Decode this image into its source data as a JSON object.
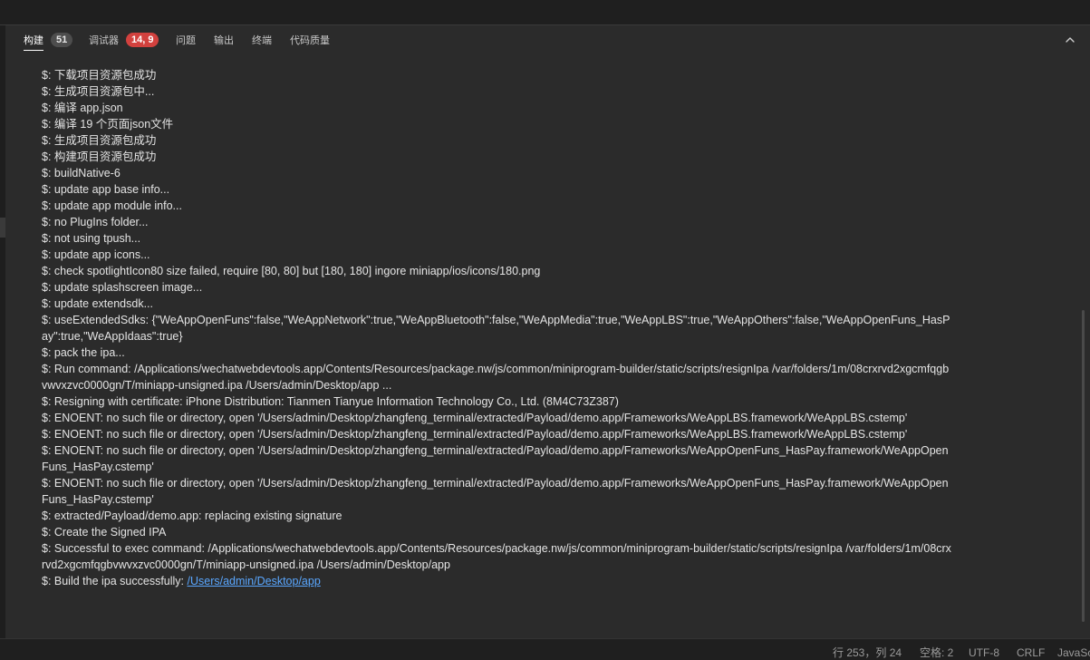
{
  "tabs": [
    {
      "label": "构建",
      "badge": "51"
    },
    {
      "label": "调试器",
      "badge": "14, 9"
    },
    {
      "label": "问题"
    },
    {
      "label": "输出"
    },
    {
      "label": "终端"
    },
    {
      "label": "代码质量"
    }
  ],
  "collapse_icon": "chevron-up-icon",
  "colors": {
    "panel_bg": "#2b2b2b",
    "badge_gray": "#4d4d4d",
    "badge_red": "#d2413e",
    "link": "#5aa7ff",
    "text": "#e4e4e4"
  },
  "log": {
    "lines": [
      "$: 下载项目资源包成功",
      "$: 生成项目资源包中...",
      "$: 编译 app.json",
      "$: 编译 19 个页面json文件",
      "$: 生成项目资源包成功",
      "$: 构建项目资源包成功",
      "$: buildNative-6",
      "$: update app base info...",
      "$: update app module info...",
      "$: no PlugIns folder...",
      "$: not using tpush...",
      "$: update app icons...",
      "$: check spotlightIcon80 size failed, require [80, 80] but [180, 180] ingore miniapp/ios/icons/180.png",
      "$: update splashscreen image...",
      "$: update extendsdk...",
      "$: useExtendedSdks: {\"WeAppOpenFuns\":false,\"WeAppNetwork\":true,\"WeAppBluetooth\":false,\"WeAppMedia\":true,\"WeAppLBS\":true,\"WeAppOthers\":false,\"WeAppOpenFuns_HasPay\":true,\"WeAppIdaas\":true}",
      "$: pack the ipa...",
      "$: Run command: /Applications/wechatwebdevtools.app/Contents/Resources/package.nw/js/common/miniprogram-builder/static/scripts/resignIpa /var/folders/1m/08crxrvd2xgcmfqgbvwvxzvc0000gn/T/miniapp-unsigned.ipa /Users/admin/Desktop/app ...",
      "$: Resigning with certificate: iPhone Distribution: Tianmen Tianyue Information Technology Co., Ltd. (8M4C73Z387)",
      "$: ENOENT: no such file or directory, open '/Users/admin/Desktop/zhangfeng_terminal/extracted/Payload/demo.app/Frameworks/WeAppLBS.framework/WeAppLBS.cstemp'",
      "$: ENOENT: no such file or directory, open '/Users/admin/Desktop/zhangfeng_terminal/extracted/Payload/demo.app/Frameworks/WeAppLBS.framework/WeAppLBS.cstemp'",
      "$: ENOENT: no such file or directory, open '/Users/admin/Desktop/zhangfeng_terminal/extracted/Payload/demo.app/Frameworks/WeAppOpenFuns_HasPay.framework/WeAppOpenFuns_HasPay.cstemp'",
      "$: ENOENT: no such file or directory, open '/Users/admin/Desktop/zhangfeng_terminal/extracted/Payload/demo.app/Frameworks/WeAppOpenFuns_HasPay.framework/WeAppOpenFuns_HasPay.cstemp'",
      "$: extracted/Payload/demo.app: replacing existing signature",
      "$: Create the Signed IPA",
      "$: Successful to exec command: /Applications/wechatwebdevtools.app/Contents/Resources/package.nw/js/common/miniprogram-builder/static/scripts/resignIpa /var/folders/1m/08crxrvd2xgcmfqgbvwvxzvc0000gn/T/miniapp-unsigned.ipa /Users/admin/Desktop/app"
    ],
    "final_prefix": "$: Build the ipa successfully: ",
    "final_link": "/Users/admin/Desktop/app"
  },
  "statusbar": {
    "position": "行 253，列 24",
    "indent": "空格: 2",
    "encoding": "UTF-8",
    "eol": "CRLF",
    "language": "JavaScript"
  }
}
